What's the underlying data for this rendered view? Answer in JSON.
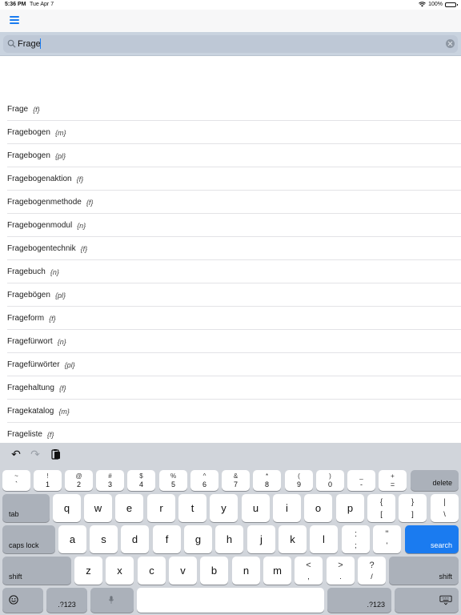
{
  "status_bar": {
    "time": "5:36 PM",
    "date": "Tue Apr 7",
    "battery": "100%"
  },
  "search": {
    "value": "Frage",
    "placeholder": ""
  },
  "results": [
    {
      "term": "Frage",
      "gender": "{f}"
    },
    {
      "term": "Fragebogen",
      "gender": "{m}"
    },
    {
      "term": "Fragebogen",
      "gender": "{pl}"
    },
    {
      "term": "Fragebogenaktion",
      "gender": "{f}"
    },
    {
      "term": "Fragebogenmethode",
      "gender": "{f}"
    },
    {
      "term": "Fragebogenmodul",
      "gender": "{n}"
    },
    {
      "term": "Fragebogentechnik",
      "gender": "{f}"
    },
    {
      "term": "Fragebuch",
      "gender": "{n}"
    },
    {
      "term": "Fragebögen",
      "gender": "{pl}"
    },
    {
      "term": "Frageform",
      "gender": "{f}"
    },
    {
      "term": "Fragefürwort",
      "gender": "{n}"
    },
    {
      "term": "Fragefürwörter",
      "gender": "{pl}"
    },
    {
      "term": "Fragehaltung",
      "gender": "{f}"
    },
    {
      "term": "Fragekatalog",
      "gender": "{m}"
    },
    {
      "term": "Frageliste",
      "gender": "{f}"
    }
  ],
  "keyboard": {
    "row1": [
      {
        "top": "~",
        "bot": "`"
      },
      {
        "top": "!",
        "bot": "1"
      },
      {
        "top": "@",
        "bot": "2"
      },
      {
        "top": "#",
        "bot": "3"
      },
      {
        "top": "$",
        "bot": "4"
      },
      {
        "top": "%",
        "bot": "5"
      },
      {
        "top": "^",
        "bot": "6"
      },
      {
        "top": "&",
        "bot": "7"
      },
      {
        "top": "*",
        "bot": "8"
      },
      {
        "top": "(",
        "bot": "9"
      },
      {
        "top": ")",
        "bot": "0"
      },
      {
        "top": "_",
        "bot": "-"
      },
      {
        "top": "+",
        "bot": "="
      }
    ],
    "delete": "delete",
    "tab": "tab",
    "row2": [
      "q",
      "w",
      "e",
      "r",
      "t",
      "y",
      "u",
      "i",
      "o",
      "p"
    ],
    "row2_sym": [
      {
        "top": "{",
        "bot": "["
      },
      {
        "top": "}",
        "bot": "]"
      },
      {
        "top": "|",
        "bot": "\\"
      }
    ],
    "caps_lock": "caps lock",
    "row3": [
      "a",
      "s",
      "d",
      "f",
      "g",
      "h",
      "j",
      "k",
      "l"
    ],
    "row3_sym": [
      {
        "top": ":",
        "bot": ";"
      },
      {
        "top": "\"",
        "bot": "'"
      }
    ],
    "search": "search",
    "shift": "shift",
    "row4": [
      "z",
      "x",
      "c",
      "v",
      "b",
      "n",
      "m"
    ],
    "row4_sym": [
      {
        "top": "<",
        "bot": ","
      },
      {
        "top": ">",
        "bot": "."
      },
      {
        "top": "?",
        "bot": "/"
      }
    ],
    "num_switch": ".?123"
  }
}
